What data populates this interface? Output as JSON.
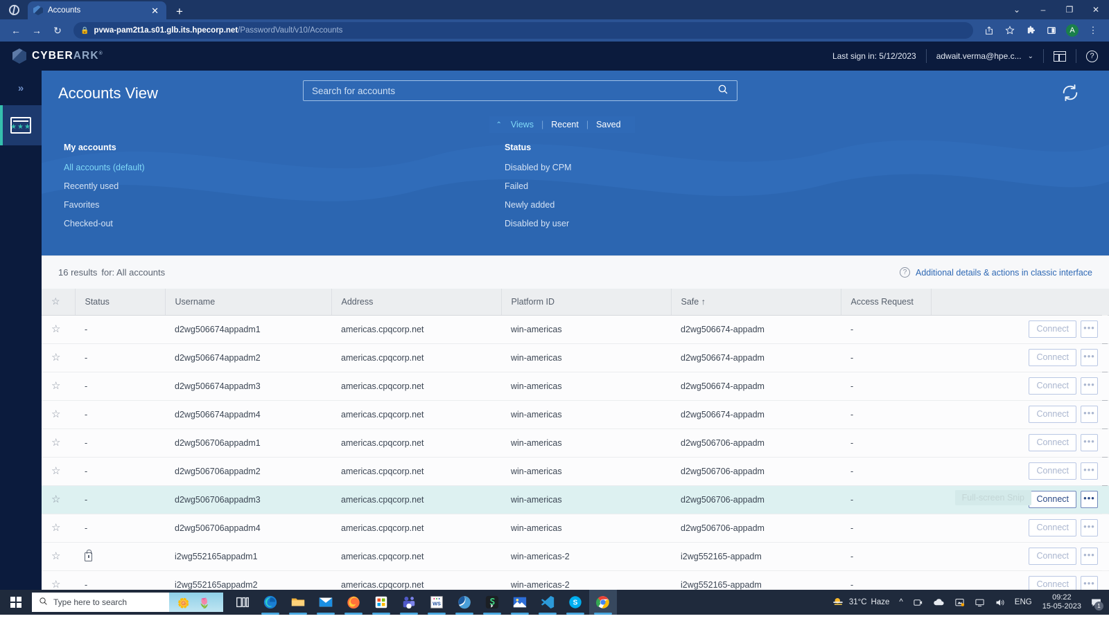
{
  "browser": {
    "tab": {
      "title": "Accounts",
      "close_label": "✕",
      "favicon": "cyberark-favicon"
    },
    "new_tab_label": "+",
    "window_controls": [
      "⌄",
      "–",
      "❐",
      "✕"
    ],
    "nav": {
      "back": "←",
      "forward": "→",
      "reload": "↻"
    },
    "url_secure_glyph": "🔒",
    "url_domain": "pvwa-pam2t1a.s01.glb.its.hpecorp.net",
    "url_path": "/PasswordVault/v10/Accounts",
    "toolbar_icons": [
      "share-icon",
      "bookmark-star-icon",
      "extensions-puzzle-icon",
      "side-panel-icon"
    ],
    "profile_initial": "A",
    "menu_glyph": "⋮"
  },
  "topbar": {
    "brand_cyber": "CYBER",
    "brand_ark": "ARK",
    "brand_tm": "®",
    "last_sign_in": "Last sign in: 5/12/2023",
    "user": "adwait.verma@hpe.c...",
    "caret": "⌄",
    "layout_icon": "panel-layout-icon",
    "help_icon": "help-circle-icon"
  },
  "leftrail": {
    "expand_glyph": "»",
    "items": [
      {
        "name": "accounts-vault",
        "label": "Accounts"
      }
    ]
  },
  "hero": {
    "title": "Accounts View",
    "search": {
      "placeholder": "Search for accounts",
      "value": "",
      "icon": "search-icon"
    },
    "refresh_icon": "refresh-sync-icon",
    "tabs": [
      {
        "label": "Views",
        "active": true,
        "chevron": "⌃"
      },
      {
        "label": "Recent",
        "active": false
      },
      {
        "label": "Saved",
        "active": false
      }
    ],
    "separator": "|",
    "columns": [
      {
        "heading": "My accounts",
        "items": [
          {
            "label": "All accounts (default)",
            "selected": true
          },
          {
            "label": "Recently used",
            "selected": false
          },
          {
            "label": "Favorites",
            "selected": false
          },
          {
            "label": "Checked-out",
            "selected": false
          }
        ]
      },
      {
        "heading": "Status",
        "items": [
          {
            "label": "Disabled by CPM",
            "selected": false
          },
          {
            "label": "Failed",
            "selected": false
          },
          {
            "label": "Newly added",
            "selected": false
          },
          {
            "label": "Disabled by user",
            "selected": false
          }
        ]
      }
    ]
  },
  "results": {
    "count_text": "16 results",
    "for_text": "for: All accounts",
    "classic_link": "Additional details & actions in classic interface",
    "help_glyph": "?"
  },
  "table": {
    "columns": [
      {
        "key": "fav",
        "label": "",
        "icon": "star-icon"
      },
      {
        "key": "status",
        "label": "Status"
      },
      {
        "key": "username",
        "label": "Username"
      },
      {
        "key": "address",
        "label": "Address"
      },
      {
        "key": "platform",
        "label": "Platform ID"
      },
      {
        "key": "safe",
        "label": "Safe ↑"
      },
      {
        "key": "access",
        "label": "Access Request"
      },
      {
        "key": "actions",
        "label": ""
      }
    ],
    "connect_label": "Connect",
    "more_label": "•••",
    "star_glyph": "☆",
    "tooltip_ghost": "Full-screen Snip",
    "rows": [
      {
        "status": "-",
        "status_icon": "",
        "username": "d2wg506674appadm1",
        "address": "americas.cpqcorp.net",
        "platform": "win-americas",
        "safe": "d2wg506674-appadm",
        "access": "-",
        "highlighted": false
      },
      {
        "status": "-",
        "status_icon": "",
        "username": "d2wg506674appadm2",
        "address": "americas.cpqcorp.net",
        "platform": "win-americas",
        "safe": "d2wg506674-appadm",
        "access": "-",
        "highlighted": false
      },
      {
        "status": "-",
        "status_icon": "",
        "username": "d2wg506674appadm3",
        "address": "americas.cpqcorp.net",
        "platform": "win-americas",
        "safe": "d2wg506674-appadm",
        "access": "-",
        "highlighted": false
      },
      {
        "status": "-",
        "status_icon": "",
        "username": "d2wg506674appadm4",
        "address": "americas.cpqcorp.net",
        "platform": "win-americas",
        "safe": "d2wg506674-appadm",
        "access": "-",
        "highlighted": false
      },
      {
        "status": "-",
        "status_icon": "",
        "username": "d2wg506706appadm1",
        "address": "americas.cpqcorp.net",
        "platform": "win-americas",
        "safe": "d2wg506706-appadm",
        "access": "-",
        "highlighted": false
      },
      {
        "status": "-",
        "status_icon": "",
        "username": "d2wg506706appadm2",
        "address": "americas.cpqcorp.net",
        "platform": "win-americas",
        "safe": "d2wg506706-appadm",
        "access": "-",
        "highlighted": false
      },
      {
        "status": "-",
        "status_icon": "",
        "username": "d2wg506706appadm3",
        "address": "americas.cpqcorp.net",
        "platform": "win-americas",
        "safe": "d2wg506706-appadm",
        "access": "-",
        "highlighted": true
      },
      {
        "status": "-",
        "status_icon": "",
        "username": "d2wg506706appadm4",
        "address": "americas.cpqcorp.net",
        "platform": "win-americas",
        "safe": "d2wg506706-appadm",
        "access": "-",
        "highlighted": false
      },
      {
        "status": "",
        "status_icon": "lock-icon",
        "username": "i2wg552165appadm1",
        "address": "americas.cpqcorp.net",
        "platform": "win-americas-2",
        "safe": "i2wg552165-appadm",
        "access": "-",
        "highlighted": false
      },
      {
        "status": "-",
        "status_icon": "",
        "username": "i2wg552165appadm2",
        "address": "americas.cpqcorp.net",
        "platform": "win-americas-2",
        "safe": "i2wg552165-appadm",
        "access": "-",
        "highlighted": false
      }
    ]
  },
  "taskbar": {
    "start_label": "windows-start-icon",
    "search_placeholder": "Type here to search",
    "apps": [
      {
        "name": "task-view-icon",
        "glyph": "⌸"
      },
      {
        "name": "microsoft-edge-icon",
        "glyph": ""
      },
      {
        "name": "file-explorer-icon",
        "glyph": ""
      },
      {
        "name": "mail-icon",
        "glyph": ""
      },
      {
        "name": "firefox-icon",
        "glyph": ""
      },
      {
        "name": "microsoft-store-icon",
        "glyph": ""
      },
      {
        "name": "microsoft-teams-icon",
        "glyph": ""
      },
      {
        "name": "ws-notes-icon",
        "glyph": "WS"
      },
      {
        "name": "outlook-icon",
        "glyph": ""
      },
      {
        "name": "snagit-icon",
        "glyph": "S"
      },
      {
        "name": "photos-icon",
        "glyph": ""
      },
      {
        "name": "vs-code-icon",
        "glyph": ""
      },
      {
        "name": "skype-icon",
        "glyph": "S"
      },
      {
        "name": "google-chrome-icon",
        "glyph": ""
      }
    ],
    "weather_temp": "31°C",
    "weather_desc": "Haze",
    "tray_glyphs": [
      "⌃",
      "camera-icon",
      "onedrive-cloud-icon",
      "screen-capture-icon",
      "display-icon",
      "volume-icon"
    ],
    "language": "ENG",
    "time": "09:22",
    "date": "15-05-2023",
    "notification_count": "1"
  }
}
